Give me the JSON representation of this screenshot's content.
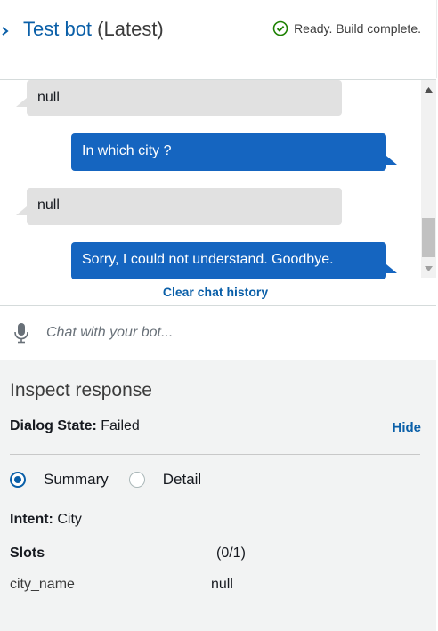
{
  "header": {
    "bot_name": "Test bot",
    "version": "(Latest)",
    "status": "Ready. Build complete."
  },
  "chat": {
    "messages": [
      {
        "from": "bot",
        "text": "null"
      },
      {
        "from": "user",
        "text": "In which city ?"
      },
      {
        "from": "bot",
        "text": "null"
      },
      {
        "from": "user",
        "text": "Sorry, I could not understand. Goodbye."
      }
    ],
    "clear_label": "Clear chat history",
    "input_placeholder": "Chat with your bot..."
  },
  "inspect": {
    "title": "Inspect response",
    "dialog_state_label": "Dialog State:",
    "dialog_state_value": "Failed",
    "hide_label": "Hide",
    "view_options": [
      "Summary",
      "Detail"
    ],
    "selected_view": "Summary",
    "intent_label": "Intent:",
    "intent_value": "City",
    "slots_label": "Slots",
    "slots_count": "(0/1)",
    "slots": [
      {
        "name": "city_name",
        "value": "null"
      }
    ]
  },
  "colors": {
    "accent": "#0a5fa8",
    "user_bubble": "#1565c0",
    "bot_bubble": "#e1e1e1",
    "success": "#1d8102"
  }
}
